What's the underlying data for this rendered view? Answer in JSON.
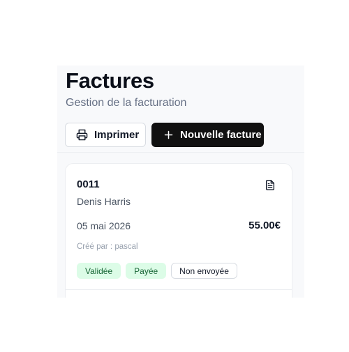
{
  "header": {
    "title": "Factures",
    "subtitle": "Gestion de la facturation"
  },
  "toolbar": {
    "print_label": "Imprimer",
    "print_icon": "printer-icon",
    "new_label": "Nouvelle facture",
    "new_icon": "plus-icon"
  },
  "invoice": {
    "number": "0011",
    "client": "Denis Harris",
    "date": "05 mai 2026",
    "amount": "55.00€",
    "created_by": "Créé par : pascal",
    "action_icon": "document-icon",
    "badges": [
      {
        "label": "Validée",
        "color": "#dcfce7"
      },
      {
        "label": "Payée",
        "color": "#dcfce7"
      },
      {
        "label": "Non envoyée",
        "color": "#ffffff"
      }
    ]
  }
}
